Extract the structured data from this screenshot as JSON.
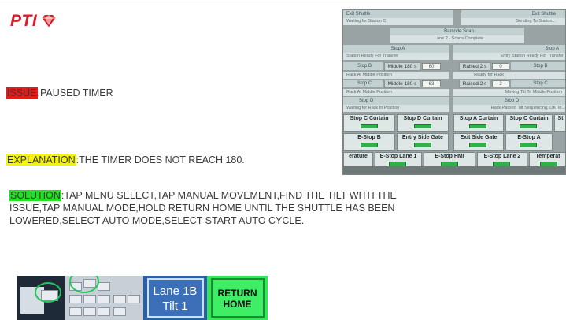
{
  "logo": {
    "text": "PTI",
    "icon": "diamond-gem-icon",
    "brand_color": "#d81e2a"
  },
  "sections": {
    "issue": {
      "tag": "ISSUE",
      "text": ":PAUSED TIMER",
      "highlight": "#e21b1b"
    },
    "explanation": {
      "tag": "EXPLANATION",
      "text": ":THE TIMER DOES NOT REACH 180.",
      "highlight": "#f5f500"
    },
    "solution": {
      "tag": "SOLUTION",
      "text": ":TAP MENU SELECT,TAP MANUAL MOVEMENT,FIND THE TILT WITH THE ISSUE,TAP MANUAL MODE,HOLD RETURN HOME UNTIL THE SHUTTLE HAS BEEN LOWERED,SELECT AUTO MODE,SELECT START AUTO CYCLE.",
      "highlight": "#22e022"
    }
  },
  "hmi": {
    "exit_shuttle_left": "Exit Shuttle",
    "waiting_left": "Waiting for Station C",
    "exit_shuttle_right": "Exit Shuttle",
    "sending_right": "Sending To Station...",
    "barcode_scan": "Barcode Scan",
    "lane_status": "Lane 2 - Scans Complete",
    "stop_a_left": "Stop A",
    "stop_a_left_sub": "Station Ready For Transfer",
    "stop_a_right": "Stop A",
    "stop_a_right_sub": "Entry Station Ready For Transfer",
    "stop_b_left": "Stop B",
    "middle_180_b": "Middle 180 s",
    "val_b": "60",
    "raised_2s_b": "Raised 2 s",
    "val_rb": "0",
    "stop_b_right": "Stop B",
    "stop_b_left_sub": "Rack At Middle Position",
    "stop_b_right_sub": "Ready for Rack",
    "stop_c_left": "Stop C",
    "middle_180_c": "Middle 180 s",
    "val_c": "63",
    "raised_2s_c": "Raised 2 s",
    "val_rc": "2",
    "stop_c_right": "Stop C",
    "stop_c_left_sub": "Rack At Middle Position",
    "stop_c_right_sub": "Moving Tilt To Middle Position",
    "stop_d_left": "Stop D",
    "stop_d_left_sub": "Waiting for Rack In Position",
    "stop_d_right": "Stop D",
    "stop_d_right_sub": "Rack Passed Tilt Sequencing, OK To...",
    "buttons_row1": [
      "Stop C Curtain",
      "Stop D Curtain",
      "Stop A Curtain",
      "Stop C Curtain",
      "St"
    ],
    "buttons_row2": [
      "E-Stop B",
      "Entry Side Gate",
      "Exit Side Gate",
      "E-Stop A"
    ],
    "buttons_row3": [
      "erature",
      "E-Stop Lane 1",
      "E-Stop HMI",
      "E-Stop Lane 2",
      "Temperat"
    ]
  },
  "thumbnails": {
    "lane_tile": [
      "Lane 1B",
      "Tilt 1"
    ],
    "return_tile": [
      "RETURN",
      "HOME"
    ]
  }
}
